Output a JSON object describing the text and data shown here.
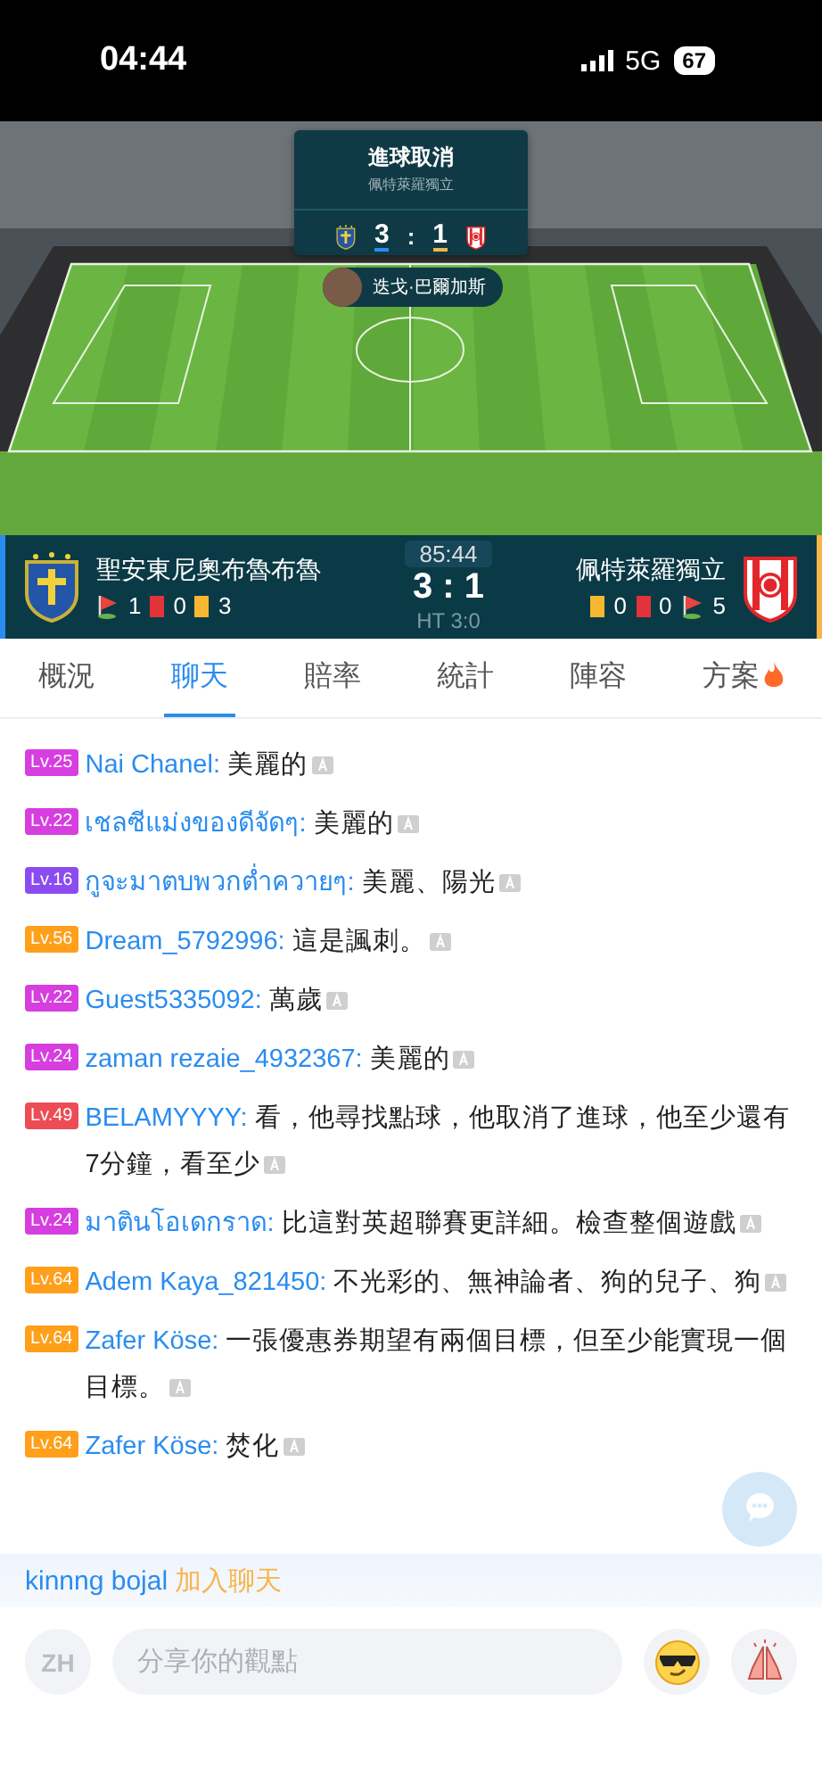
{
  "status_bar": {
    "time": "04:44",
    "network": "5G",
    "battery": "67"
  },
  "goal_popup": {
    "title": "進球取消",
    "team": "佩特萊羅獨立",
    "home_score": "3",
    "separator": ":",
    "away_score": "1",
    "player": "迭戈·巴爾加斯"
  },
  "scoreboard": {
    "home": {
      "name": "聖安東尼奧布魯布魯",
      "stats": [
        {
          "kind": "corner",
          "count": "1"
        },
        {
          "kind": "red",
          "count": "0"
        },
        {
          "kind": "yellow",
          "count": "3"
        }
      ]
    },
    "clock": "85:44",
    "score": "3 : 1",
    "half_time": "HT 3:0",
    "away": {
      "name": "佩特萊羅獨立",
      "stats": [
        {
          "kind": "yellow",
          "count": "0"
        },
        {
          "kind": "red",
          "count": "0"
        },
        {
          "kind": "corner",
          "count": "5"
        }
      ]
    }
  },
  "tabs": [
    {
      "label": "概況",
      "selected": false,
      "hot": false
    },
    {
      "label": "聊天",
      "selected": true,
      "hot": false
    },
    {
      "label": "賠率",
      "selected": false,
      "hot": false
    },
    {
      "label": "統計",
      "selected": false,
      "hot": false
    },
    {
      "label": "陣容",
      "selected": false,
      "hot": false
    },
    {
      "label": "方案",
      "selected": false,
      "hot": true
    }
  ],
  "messages": [
    {
      "level": "Lv.25",
      "color": "#d63ee0",
      "user": "Nai Chanel:",
      "text": "美麗的"
    },
    {
      "level": "Lv.22",
      "color": "#d63ee0",
      "user": "เชลซีแม่งของดีจัดๆ:",
      "text": "美麗的"
    },
    {
      "level": "Lv.16",
      "color": "#8a4cf0",
      "user": "กูจะมาตบพวกต่ำควายๆ:",
      "text": "美麗、陽光"
    },
    {
      "level": "Lv.56",
      "color": "#ff9f1a",
      "user": "Dream_5792996:",
      "text": "這是諷刺。"
    },
    {
      "level": "Lv.22",
      "color": "#d63ee0",
      "user": "Guest5335092:",
      "text": "萬歲"
    },
    {
      "level": "Lv.24",
      "color": "#d63ee0",
      "user": "zaman rezaie_4932367:",
      "text": "美麗的"
    },
    {
      "level": "Lv.49",
      "color": "#ec4d55",
      "user": "BELAMYYYY:",
      "text": "看，他尋找點球，他取消了進球，他至少還有7分鐘，看至少"
    },
    {
      "level": "Lv.24",
      "color": "#d63ee0",
      "user": "มาตินโอเดกราด:",
      "text": "比這對英超聯賽更詳細。檢查整個遊戲"
    },
    {
      "level": "Lv.64",
      "color": "#ff9f1a",
      "user": "Adem Kaya_821450:",
      "text": "不光彩的、無神論者、狗的兒子、狗"
    },
    {
      "level": "Lv.64",
      "color": "#ff9f1a",
      "user": "Zafer Köse:",
      "text": "一張優惠券期望有兩個目標，但至少能實現一個目標。"
    },
    {
      "level": "Lv.64",
      "color": "#ff9f1a",
      "user": "Zafer Köse:",
      "text": "焚化"
    }
  ],
  "join_notice": {
    "user": "kinnng bojal",
    "action": "加入聊天"
  },
  "composer": {
    "language": "ZH",
    "placeholder": "分享你的觀點"
  }
}
